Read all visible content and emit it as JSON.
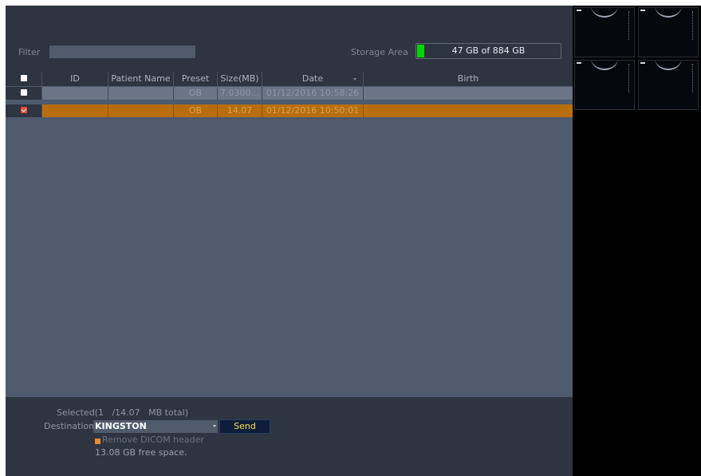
{
  "filter": {
    "label": "Filter",
    "value": ""
  },
  "storage": {
    "label": "Storage Area",
    "text": "47 GB of 884 GB",
    "used_fraction": 0.053,
    "fill_color": "#00d400"
  },
  "table": {
    "columns": [
      "",
      "ID",
      "Patient Name",
      "Preset",
      "Size(MB)",
      "Date",
      "Birth"
    ],
    "rows": [
      {
        "checked": false,
        "id": "",
        "patient_name": "",
        "preset": "OB",
        "size": "7.0300...",
        "date": "01/12/2016 10:58:26",
        "birth": ""
      },
      {
        "checked": true,
        "id": "",
        "patient_name": "",
        "preset": "OB",
        "size": "14.07",
        "date": "01/12/2016 10:50:01",
        "birth": ""
      }
    ],
    "selected_row_color": "#b86e0e"
  },
  "footer": {
    "selected_text": "Selected(1   /14.07   MB total)",
    "destination_label": "Destination",
    "destination_value": "KINGSTON",
    "send_label": "Send",
    "remove_dicom_label": "Remove DICOM header",
    "free_space": "13.08 GB free space."
  },
  "thumbnails": [
    {
      "name": "ultrasound-thumbnail-1"
    },
    {
      "name": "ultrasound-thumbnail-2"
    },
    {
      "name": "ultrasound-thumbnail-3"
    },
    {
      "name": "ultrasound-thumbnail-4"
    }
  ]
}
